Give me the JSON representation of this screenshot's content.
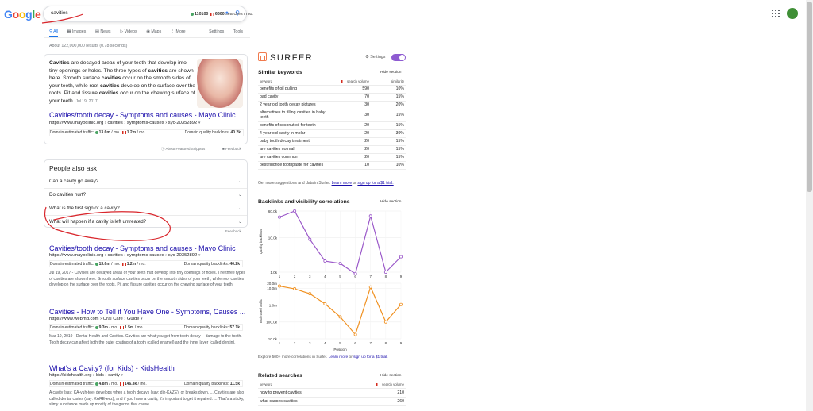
{
  "logo": {
    "letters": [
      "G",
      "o",
      "o",
      "g",
      "l",
      "e"
    ],
    "colors": [
      "#4285f4",
      "#ea4335",
      "#fbbc05",
      "#4285f4",
      "#34a853",
      "#ea4335"
    ]
  },
  "search": {
    "query": "cavities",
    "volume_global": "110100",
    "volume_local": "6600",
    "volume_suffix": "searches / mo."
  },
  "tabs": [
    {
      "label": "All",
      "active": true
    },
    {
      "label": "Images",
      "active": false
    },
    {
      "label": "News",
      "active": false
    },
    {
      "label": "Videos",
      "active": false
    },
    {
      "label": "Maps",
      "active": false
    },
    {
      "label": "More",
      "active": false
    }
  ],
  "settings_label": "Settings",
  "tools_label": "Tools",
  "result_stats": "About 122,000,000 results (0.78 seconds)",
  "featured": {
    "text_html": "<b>Cavities</b> are decayed areas of your teeth that develop into tiny openings or holes. The three types of <b>cavities</b> are shown here. Smooth surface <b>cavities</b> occur on the smooth sides of your teeth, while root <b>cavities</b> develop on the surface over the roots. Pit and fissure <b>cavities</b> occur on the chewing surface of your teeth.",
    "date": "Jul 19, 2017",
    "title": "Cavities/tooth decay - Symptoms and causes - Mayo Clinic",
    "url": "https://www.mayoclinic.org › cavities › symptoms-causes › syc-20352892",
    "traffic_label": "Domain estimated traffic:",
    "traffic_global": "13.6m",
    "traffic_local": "1.2m",
    "traffic_suffix": "/ mo.",
    "backlinks_label": "Domain quality backlinks:",
    "backlinks": "40.2k",
    "about_label": "About Featured Snippets",
    "feedback": "Feedback"
  },
  "paa": {
    "title": "People also ask",
    "questions": [
      "Can a cavity go away?",
      "Do cavities hurt?",
      "What is the first sign of a cavity?",
      "What will happen if a cavity is left untreated?"
    ],
    "feedback": "Feedback"
  },
  "results": [
    {
      "title": "Cavities/tooth decay - Symptoms and causes - Mayo Clinic",
      "url": "https://www.mayoclinic.org › cavities › symptoms-causes › syc-20352892",
      "traffic_global": "13.6m",
      "traffic_local": "1.2m",
      "backlinks": "40.2k",
      "desc": "Jul 19, 2017 - Cavities are decayed areas of your teeth that develop into tiny openings or holes. The three types of cavities are shown here. Smooth surface cavities occur on the smooth sides of your teeth, while root cavities develop on the surface over the roots. Pit and fissure cavities occur on the chewing surface of your teeth."
    },
    {
      "title": "Cavities - How to Tell if You Have One - Symptoms, Causes ...",
      "url": "https://www.webmd.com › Oral Care › Guide",
      "traffic_global": "9.3m",
      "traffic_local": "1.5m",
      "backlinks": "57.1k",
      "desc": "Mar 10, 2019 - Dental Health and Cavities. Cavities are what you get from tooth decay -- damage to the tooth. Tooth decay can affect both the outer coating of a tooth (called enamel) and the inner layer (called dentin)."
    },
    {
      "title": "What's a Cavity? (for Kids) - KidsHealth",
      "url": "https://kidshealth.org › kids › cavity",
      "traffic_global": "4.8m",
      "traffic_local": "146.3k",
      "backlinks": "11.5k",
      "desc": "A cavity (say: KA-vuh-tee) develops when a tooth decays (say: dih-KAZE), or breaks down. ... Cavities are also called dental caries (say: KARE-eez), and if you have a cavity, it's important to get it repaired. ... That's a sticky, slimy substance made up mostly of the germs that cause ..."
    }
  ],
  "surfer": {
    "brand": "SURFER",
    "settings": "Settings",
    "hide": "Hide section",
    "similar": {
      "title": "Similar keywords",
      "col_keyword": "keyword",
      "col_volume": "search volume",
      "col_similarity": "similarity",
      "rows": [
        [
          "benefits of oil pulling",
          "590",
          "10%"
        ],
        [
          "bad cavity",
          "70",
          "15%"
        ],
        [
          "2 year old tooth decay pictures",
          "30",
          "20%"
        ],
        [
          "alternatives to filling cavities in baby teeth",
          "30",
          "15%"
        ],
        [
          "benefits of coconut oil for teeth",
          "20",
          "15%"
        ],
        [
          "4 year old cavity in molar",
          "20",
          "30%"
        ],
        [
          "baby tooth decay treatment",
          "20",
          "15%"
        ],
        [
          "are cavities normal",
          "20",
          "15%"
        ],
        [
          "are cavities common",
          "20",
          "15%"
        ],
        [
          "best fluoride toothpaste for cavities",
          "10",
          "10%"
        ]
      ],
      "foot_text": "Get more suggestions and data in Surfer.",
      "foot_learn": "Learn more",
      "foot_or": "or",
      "foot_signup": "sign up for a $1 trial."
    },
    "backlinks": {
      "title": "Backlinks and visibility correlations",
      "foot_text": "Explore 500+ more correlations in Surfer.",
      "foot_learn": "Learn more",
      "foot_or": "or",
      "foot_signup": "sign up for a $1 trial."
    },
    "related": {
      "title": "Related searches",
      "col_keyword": "keyword",
      "col_volume": "search volume",
      "rows": [
        [
          "how to prevent cavities",
          "210"
        ],
        [
          "what causes cavities",
          "260"
        ]
      ]
    }
  },
  "chart_data": [
    {
      "type": "line",
      "ylabel": "Quality backlinks",
      "x": [
        1,
        2,
        3,
        4,
        5,
        6,
        7,
        8,
        9
      ],
      "y_ticks": [
        "60.0k",
        "10.0k",
        "1.0k"
      ],
      "y_scale": "log",
      "ylim": [
        1000,
        60000
      ],
      "series": [
        {
          "color": "#9b59c9",
          "values": [
            40000,
            60000,
            9000,
            2100,
            1800,
            900,
            43000,
            1000,
            2800
          ]
        }
      ]
    },
    {
      "type": "line",
      "xlabel": "Position",
      "ylabel": "Estimated traffic",
      "x": [
        1,
        2,
        3,
        4,
        5,
        6,
        7,
        8,
        9
      ],
      "y_ticks": [
        "20.0m",
        "10.0m",
        "1.0m",
        "100.0k",
        "10.0k"
      ],
      "y_scale": "log",
      "ylim": [
        10000,
        20000000
      ],
      "series": [
        {
          "color": "#f0901f",
          "values": [
            13600000,
            9300000,
            4800000,
            1200000,
            200000,
            18000,
            12000000,
            100000,
            1100000
          ]
        }
      ]
    }
  ]
}
